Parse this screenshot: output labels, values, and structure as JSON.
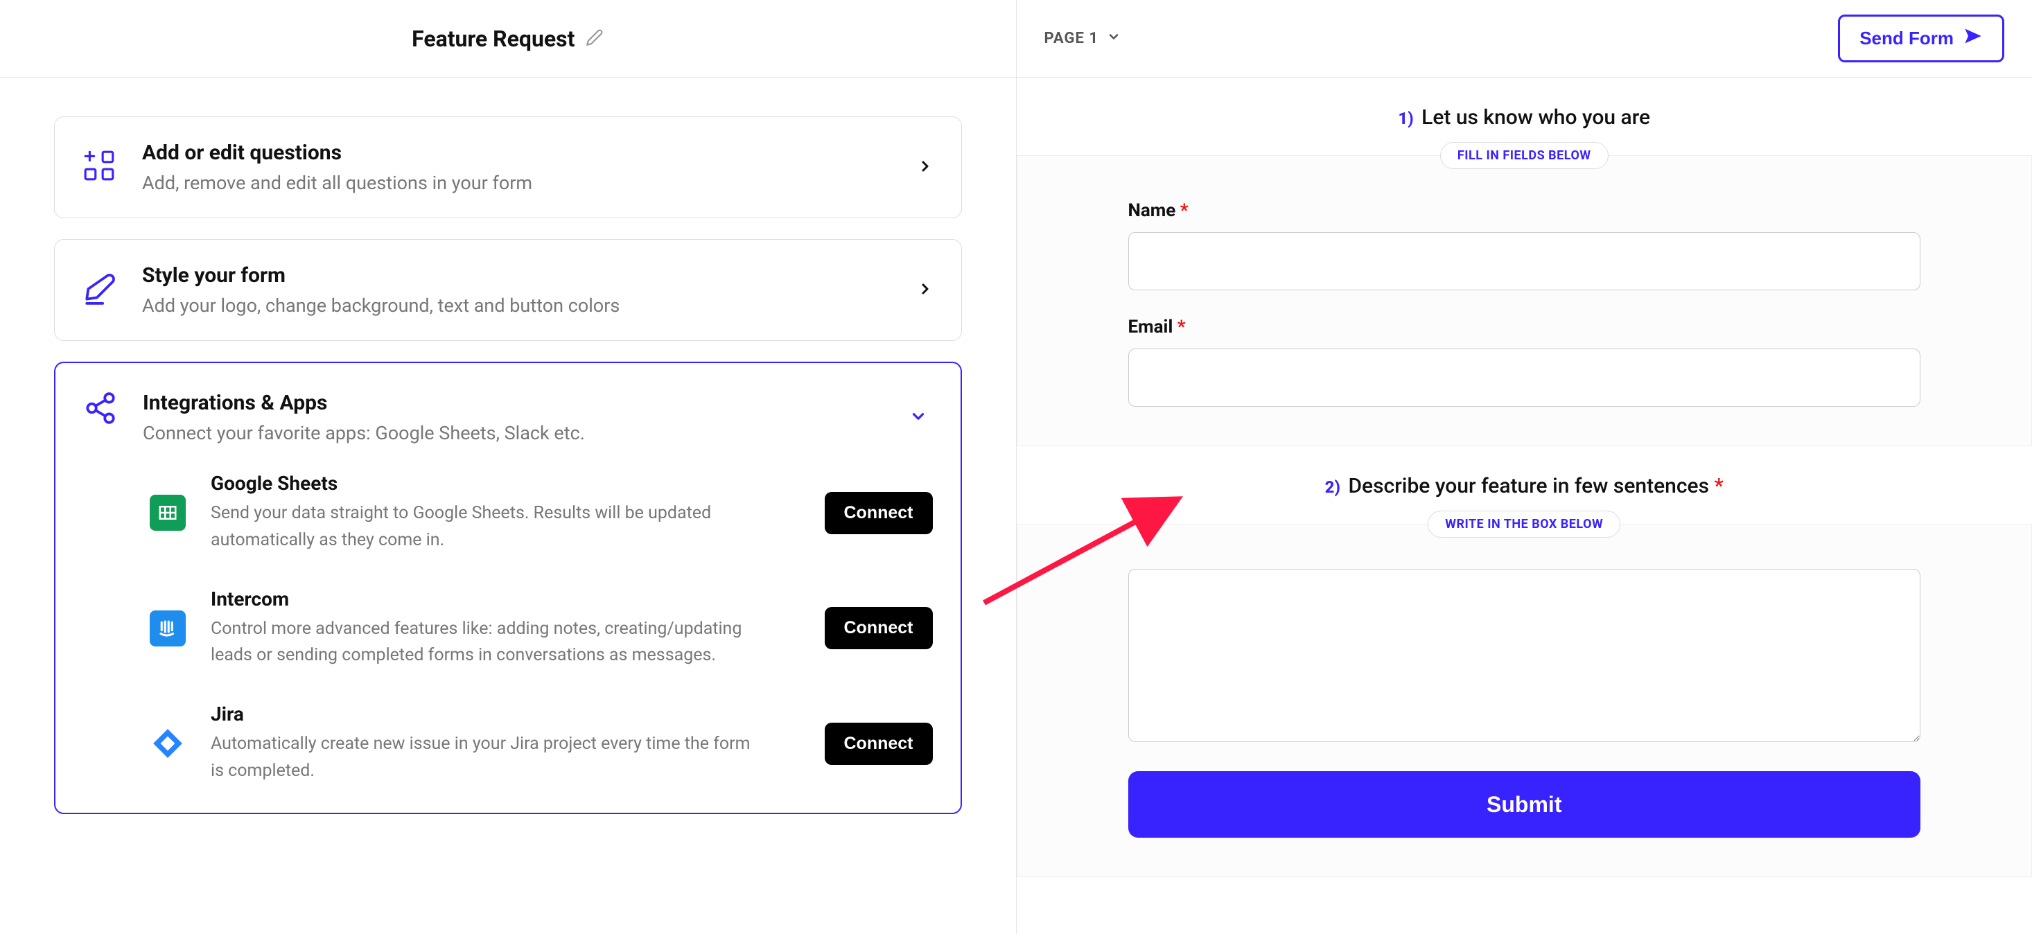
{
  "left": {
    "title": "Feature Request",
    "cards": {
      "add_questions": {
        "title": "Add or edit questions",
        "subtitle": "Add, remove and edit all questions in your form"
      },
      "style_form": {
        "title": "Style your form",
        "subtitle": "Add your logo, change background, text and button colors"
      },
      "integrations": {
        "title": "Integrations & Apps",
        "subtitle": "Connect your favorite apps: Google Sheets, Slack etc."
      }
    },
    "integrations": [
      {
        "name": "Google Sheets",
        "desc": "Send your data straight to Google Sheets. Results will be updated automatically as they come in.",
        "btn": "Connect"
      },
      {
        "name": "Intercom",
        "desc": "Control more advanced features like: adding notes, creating/updating leads or sending completed forms in conversations as messages.",
        "btn": "Connect"
      },
      {
        "name": "Jira",
        "desc": "Automatically create new issue in your Jira project every time the form is completed.",
        "btn": "Connect"
      }
    ]
  },
  "right": {
    "page_label": "PAGE 1",
    "send_label": "Send Form",
    "sections": [
      {
        "num": "1)",
        "title": "Let us know who you are",
        "badge": "FILL IN FIELDS BELOW",
        "fields": [
          {
            "label": "Name",
            "required": true,
            "type": "text"
          },
          {
            "label": "Email",
            "required": true,
            "type": "text"
          }
        ]
      },
      {
        "num": "2)",
        "title": "Describe your feature in few sentences",
        "required": true,
        "badge": "WRITE IN THE BOX BELOW",
        "type": "textarea"
      }
    ],
    "submit": "Submit"
  }
}
